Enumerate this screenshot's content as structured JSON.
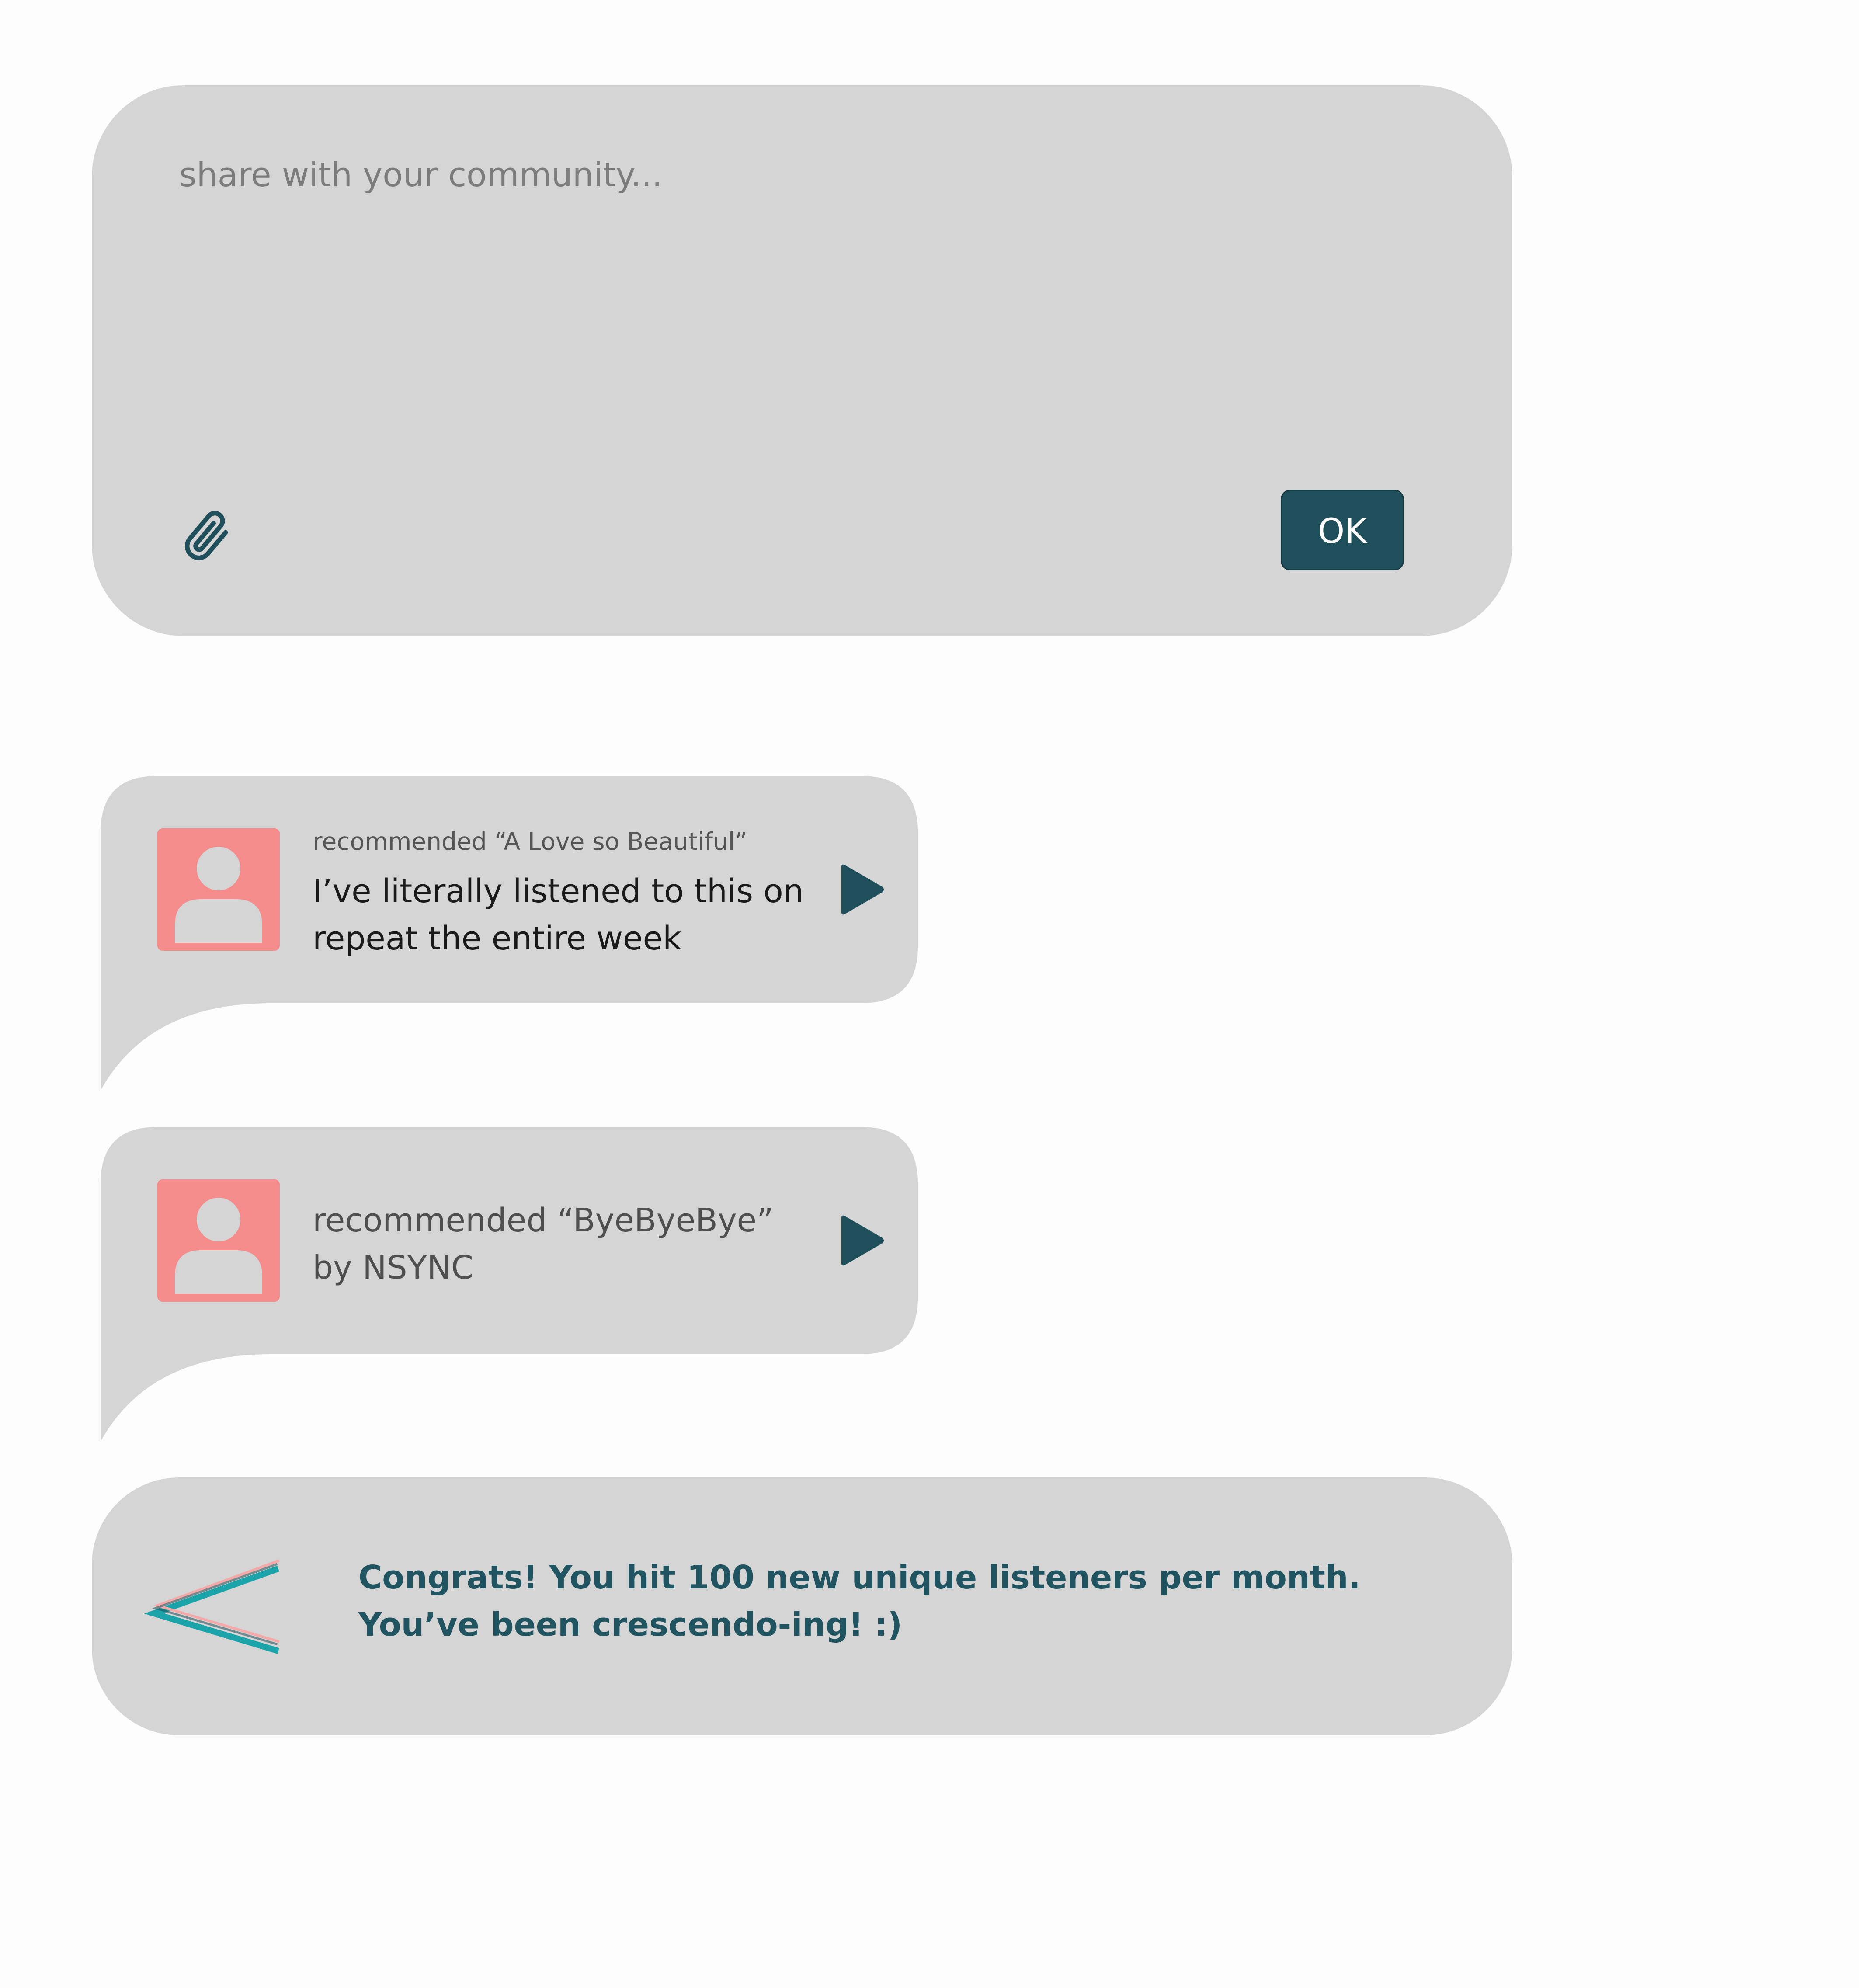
{
  "composer": {
    "placeholder": "share with your community...",
    "value": "",
    "ok_label": "OK",
    "attach_icon": "paperclip-icon"
  },
  "feed": [
    {
      "label": "recommended “A Love so Beautiful”",
      "message_lines": [
        "I’ve literally listened to this on",
        "repeat the entire week"
      ],
      "avatar_icon": "user-avatar-icon",
      "action_icon": "play-icon"
    },
    {
      "label": "",
      "message_lines": [
        "recommended “ByeByeBye”",
        "by NSYNC"
      ],
      "avatar_icon": "user-avatar-icon",
      "action_icon": "play-icon"
    }
  ],
  "notification": {
    "icon": "crescendo-icon",
    "lines": [
      "Congrats! You hit 100 new unique listeners per month.",
      "You’ve been crescendo-ing! :)"
    ]
  },
  "colors": {
    "background": "#fdfdfd",
    "card": "#d5d5d5",
    "accent": "#1f4f5a",
    "avatar": "#f48c8c",
    "notification_text": "#1f5460",
    "crescendo_teal": "#1aa3a8",
    "crescendo_pink": "#f4a9a9"
  }
}
